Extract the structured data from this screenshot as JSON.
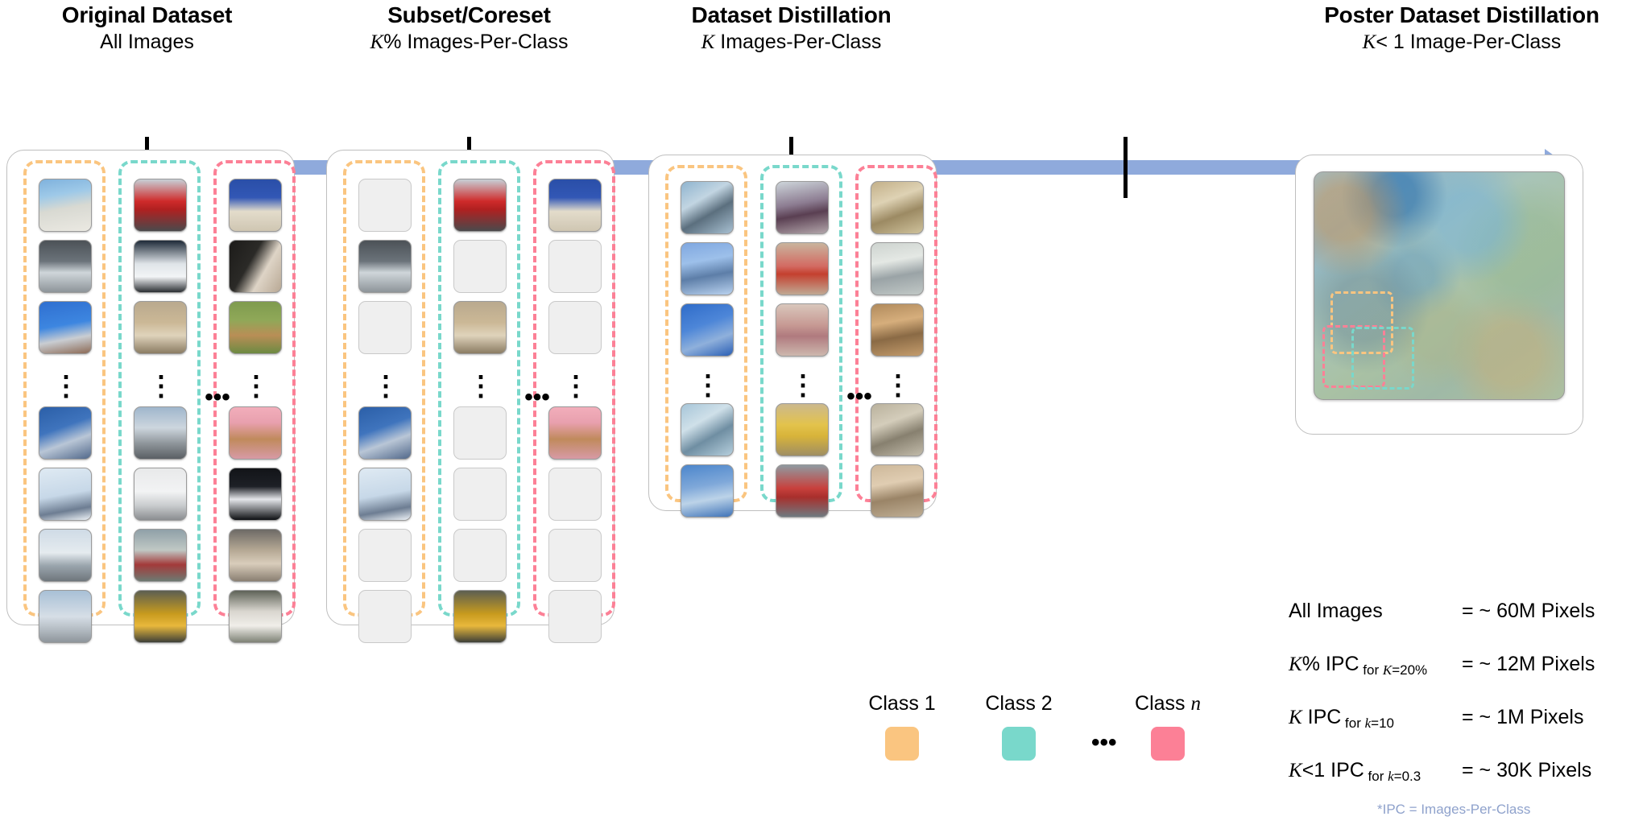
{
  "columns": [
    {
      "id": "original",
      "title": "Original Dataset",
      "subtitle_math": "",
      "subtitle": "All Images"
    },
    {
      "id": "subset",
      "title": "Subset/Coreset",
      "subtitle_math": "K",
      "subtitle": "% Images-Per-Class"
    },
    {
      "id": "distillation",
      "title": "Dataset Distillation",
      "subtitle_math": "K",
      "subtitle": " Images-Per-Class"
    },
    {
      "id": "poster",
      "title": "Poster Dataset Distillation",
      "subtitle_math": "K",
      "subtitle": "< 1 Image-Per-Class"
    }
  ],
  "timeline": {
    "bar_color": "#8FAADC",
    "tick_color": "#000000",
    "direction": "left-to-right",
    "tick_count": 4
  },
  "classes": [
    {
      "id": "class1",
      "label": "Class 1",
      "color": "#FAC580",
      "content": "airplane"
    },
    {
      "id": "class2",
      "label": "Class 2",
      "color": "#79D8CB",
      "content": "automobile"
    },
    {
      "id": "classn",
      "label": "Class n",
      "color": "#FC8096",
      "content": "dog"
    }
  ],
  "legend": {
    "ellipsis": "•••",
    "items": [
      {
        "label": "Class 1",
        "color": "#FAC580"
      },
      {
        "label": "Class 2",
        "color": "#79D8CB"
      },
      {
        "label": "Class n",
        "color": "#FC8096",
        "italic_suffix": "n"
      }
    ]
  },
  "ellipsis": {
    "vertical": "⋮",
    "horizontal": "•••"
  },
  "panels": {
    "original": {
      "name": "Original Dataset",
      "rows_before_gap": 3,
      "rows_after_gap": 4,
      "filled": "all"
    },
    "subset": {
      "name": "Subset/Coreset",
      "rows_before_gap": 3,
      "rows_after_gap": 4,
      "filled": "sparse"
    },
    "distillation": {
      "name": "Dataset Distillation",
      "rows_before_gap": 3,
      "rows_after_gap": 2,
      "filled": "all-synthetic"
    },
    "poster": {
      "name": "Poster Dataset Distillation",
      "single_image": true
    }
  },
  "pixel_counts": {
    "rows": [
      {
        "math": "",
        "label": "All Images",
        "subscript": "",
        "value": "= ~ 60M Pixels"
      },
      {
        "math": "K",
        "label": "% IPC",
        "subscript": "for K=20%",
        "value": "= ~ 12M Pixels"
      },
      {
        "math": "K",
        "label": " IPC",
        "subscript": "for k=10",
        "value": "= ~ 1M Pixels"
      },
      {
        "math": "K",
        "label": "<1 IPC",
        "subscript": "for k=0.3",
        "value": "= ~ 30K Pixels"
      }
    ],
    "footnote": "*IPC = Images-Per-Class",
    "footnote_color": "#8FA2CC"
  }
}
